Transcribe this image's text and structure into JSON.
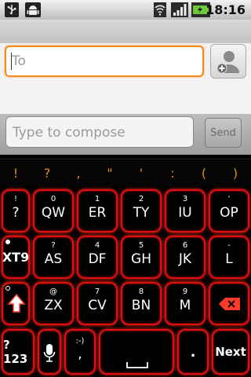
{
  "status_bar": {
    "time": "18:16"
  },
  "to_field": {
    "placeholder": "To"
  },
  "compose": {
    "placeholder": "Type to compose",
    "send_label": "Send"
  },
  "punctuation": [
    "!",
    "?",
    ",",
    "\"",
    "'",
    ":",
    "(",
    ")"
  ],
  "keys": {
    "row1": [
      {
        "top": "!",
        "main": "?"
      },
      {
        "top": "0",
        "main": "QW"
      },
      {
        "top": "1",
        "main": "ER"
      },
      {
        "top": "2",
        "main": "TY"
      },
      {
        "top": "3",
        "main": "IU"
      },
      {
        "top": "'",
        "main": "OP"
      }
    ],
    "row2": [
      {
        "main": "XT9"
      },
      {
        "top": "?",
        "main": "AS"
      },
      {
        "top": "4",
        "main": "DF"
      },
      {
        "top": "5",
        "main": "GH"
      },
      {
        "top": "6",
        "main": "JK"
      },
      {
        "top": "-",
        "main": "L"
      }
    ],
    "row3": [
      {
        "top": "@",
        "main": "ZX"
      },
      {
        "top": "7",
        "main": "CV"
      },
      {
        "top": "8",
        "main": "BN"
      },
      {
        "top": "9",
        "main": "M"
      }
    ],
    "row4": [
      {
        "main": "?123"
      },
      {
        "top": ":-)",
        "main": ","
      },
      {
        "main": "."
      },
      {
        "main": "Next"
      }
    ]
  },
  "icons": [
    "usb-icon",
    "android-icon",
    "wifi-icon",
    "signal-icon",
    "battery-icon",
    "add-contact-icon",
    "shift-icon",
    "backspace-icon",
    "mic-icon",
    "space-icon"
  ],
  "colors": {
    "key_glow": "#e01010",
    "focus_orange": "#f08c1a",
    "punct_orange": "#e48a1a"
  }
}
